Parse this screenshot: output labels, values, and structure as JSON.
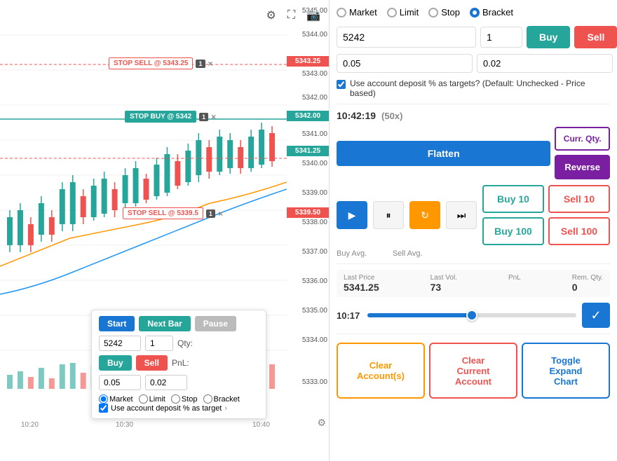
{
  "chart": {
    "toolbar": {
      "settings_icon": "⚙",
      "expand_icon": "⛶",
      "camera_icon": "📷"
    },
    "price_labels": [
      "5345.00",
      "5344.00",
      "5343.25",
      "5343.00",
      "5342.00",
      "5341.25",
      "5341.00",
      "5340.00",
      "5339.50",
      "5339.00",
      "5338.00",
      "5337.00",
      "5336.00",
      "5335.00",
      "5334.00",
      "5333.00"
    ],
    "highlighted_prices": {
      "top": "5343.25",
      "mid": "5342.00",
      "midlow": "5341.25",
      "low": "5339.50"
    },
    "order_tags": [
      {
        "label": "STOP SELL @ 5343.25",
        "type": "sell",
        "qty": "1",
        "top_pct": 16
      },
      {
        "label": "STOP BUY @ 5342",
        "type": "buy",
        "qty": "1",
        "top_pct": 28
      },
      {
        "label": "STOP SELL @ 5339.5",
        "type": "sell",
        "qty": "1",
        "top_pct": 60
      }
    ],
    "time_labels": [
      "10:20",
      "10:30",
      "10:40"
    ],
    "settings_bottom": "⚙"
  },
  "trading_panel": {
    "start_label": "Start",
    "next_bar_label": "Next Bar",
    "pause_label": "Pause",
    "price_value": "5242",
    "qty_value": "1",
    "qty_label": "Qty:",
    "buy_label": "Buy",
    "sell_label": "Sell",
    "pnl_label": "PnL:",
    "sl_value": "0.05",
    "tp_value": "0.02",
    "order_types": [
      "Market",
      "Limit",
      "Stop",
      "Bracket"
    ],
    "selected_order": "Market",
    "checkbox_label": "Use account deposit % as target",
    "more_icon": "›"
  },
  "right_panel": {
    "order_types": [
      {
        "label": "Market",
        "selected": false
      },
      {
        "label": "Limit",
        "selected": false
      },
      {
        "label": "Stop",
        "selected": false
      },
      {
        "label": "Bracket",
        "selected": true
      }
    ],
    "price_value": "5242",
    "qty_value": "1",
    "buy_label": "Buy",
    "sell_label": "Sell",
    "sl_value": "0.05",
    "tp_value": "0.02",
    "checkbox_label": "Use account deposit % as targets? (Default: Unchecked - Price based)",
    "time_display": "10:42:19",
    "multiplier": "(50x)",
    "flatten_label": "Flatten",
    "curr_qty_label": "Curr. Qty.",
    "reverse_label": "Reverse",
    "buy10_label": "Buy 10",
    "sell10_label": "Sell 10",
    "buy100_label": "Buy 100",
    "sell100_label": "Sell 100",
    "buy_avg_label": "Buy Avg.",
    "sell_avg_label": "Sell Avg.",
    "stats": {
      "last_price_label": "Last Price",
      "last_price_value": "5341.25",
      "last_vol_label": "Last Vol.",
      "last_vol_value": "73",
      "pnl_label": "PnL",
      "pnl_value": "",
      "rem_qty_label": "Rem. Qty.",
      "rem_qty_value": "0"
    },
    "timeline_time": "10:17",
    "confirm_icon": "✓",
    "bottom_actions": [
      {
        "label": "Clear\nAccount(s)",
        "type": "yellow"
      },
      {
        "label": "Clear\nCurrent\nAccount",
        "type": "red"
      },
      {
        "label": "Toggle\nExpand\nChart",
        "type": "blue"
      }
    ]
  }
}
